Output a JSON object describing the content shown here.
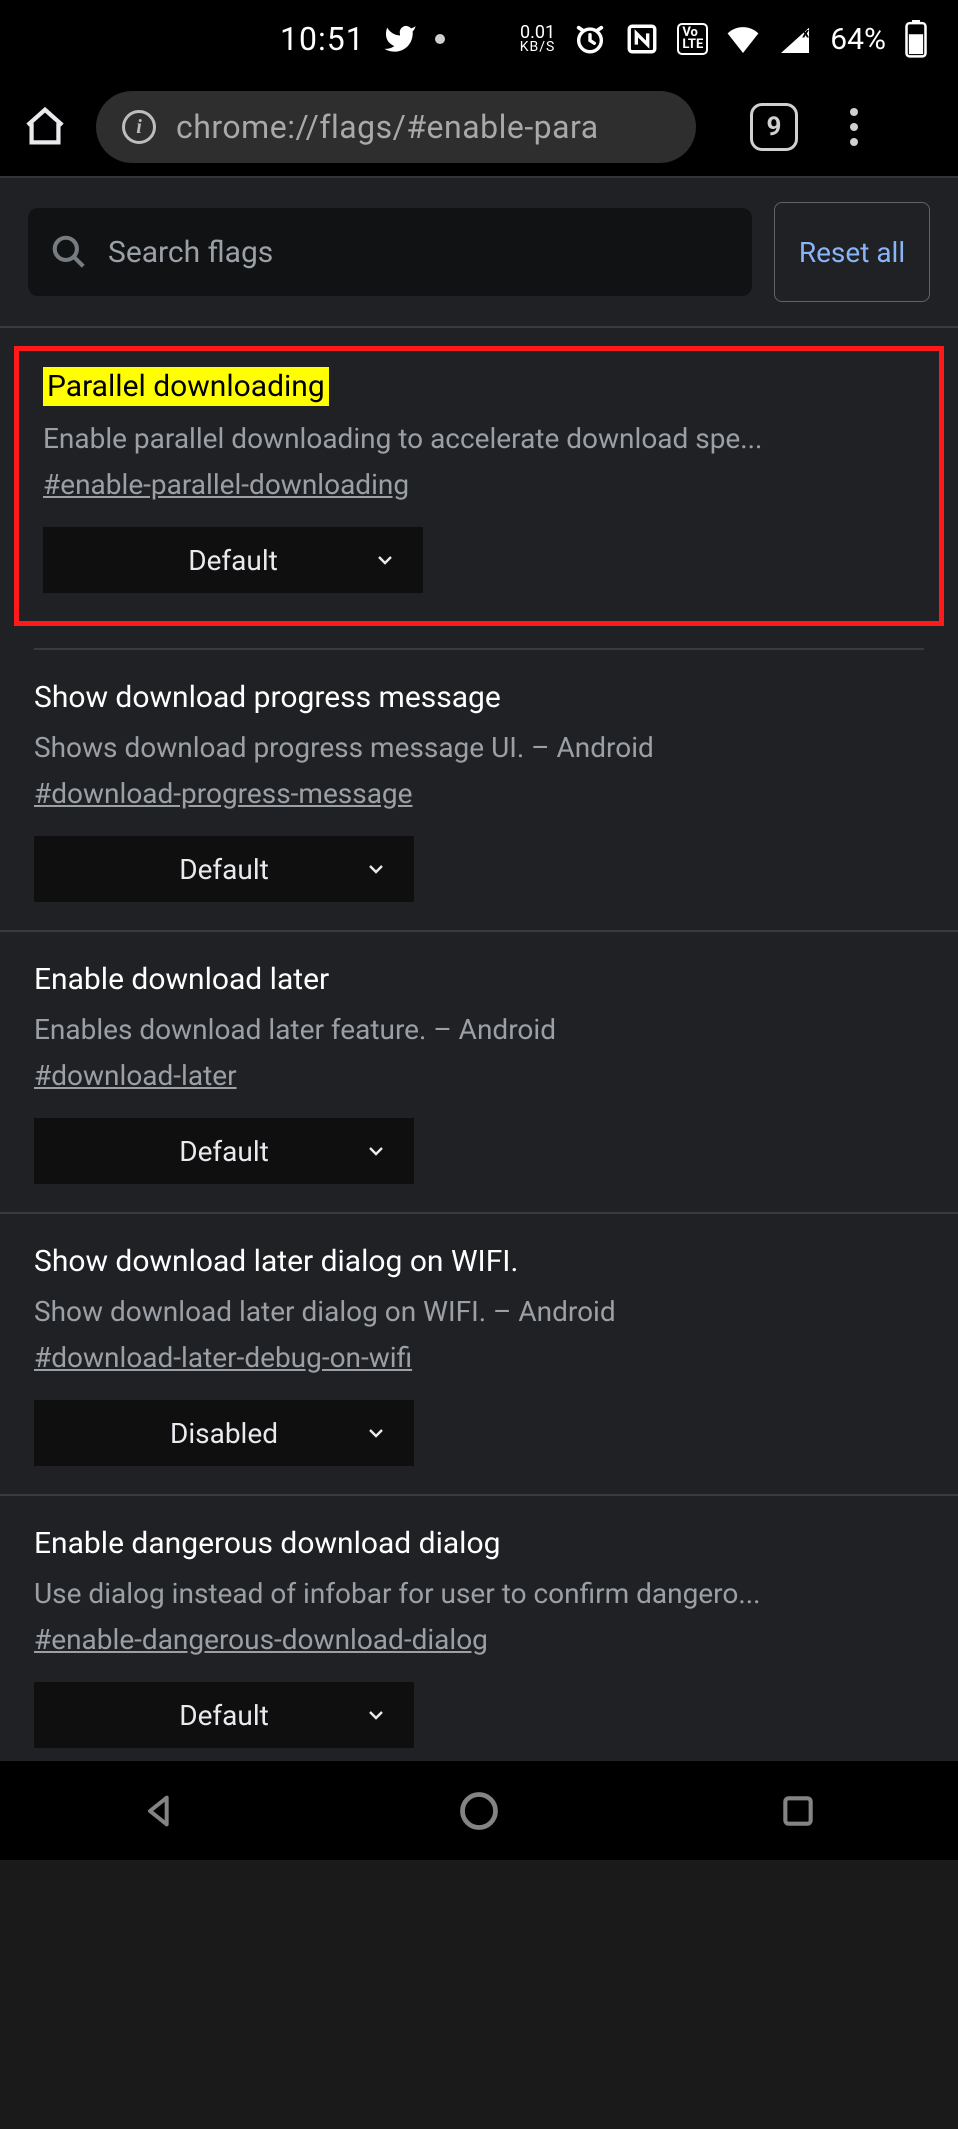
{
  "status": {
    "time": "10:51",
    "kbps_value": "0.01",
    "kbps_label": "KB/S",
    "volte_label": "Vo\nLTE",
    "battery_pct": "64%"
  },
  "browser": {
    "url": "chrome://flags/#enable-para",
    "tab_count": "9"
  },
  "search": {
    "placeholder": "Search flags",
    "reset_label": "Reset all"
  },
  "flags": [
    {
      "title": "Parallel downloading",
      "desc": "Enable parallel downloading to accelerate download spe...",
      "hash": "#enable-parallel-downloading",
      "value": "Default",
      "highlighted": true
    },
    {
      "title": "Show download progress message",
      "desc": "Shows download progress message UI. – Android",
      "hash": "#download-progress-message",
      "value": "Default"
    },
    {
      "title": "Enable download later",
      "desc": "Enables download later feature. – Android",
      "hash": "#download-later",
      "value": "Default"
    },
    {
      "title": "Show download later dialog on WIFI.",
      "desc": "Show download later dialog on WIFI. – Android",
      "hash": "#download-later-debug-on-wifi",
      "value": "Disabled"
    },
    {
      "title": "Enable dangerous download dialog",
      "desc": "Use dialog instead of infobar for user to confirm dangero...",
      "hash": "#enable-dangerous-download-dialog",
      "value": "Default"
    }
  ]
}
